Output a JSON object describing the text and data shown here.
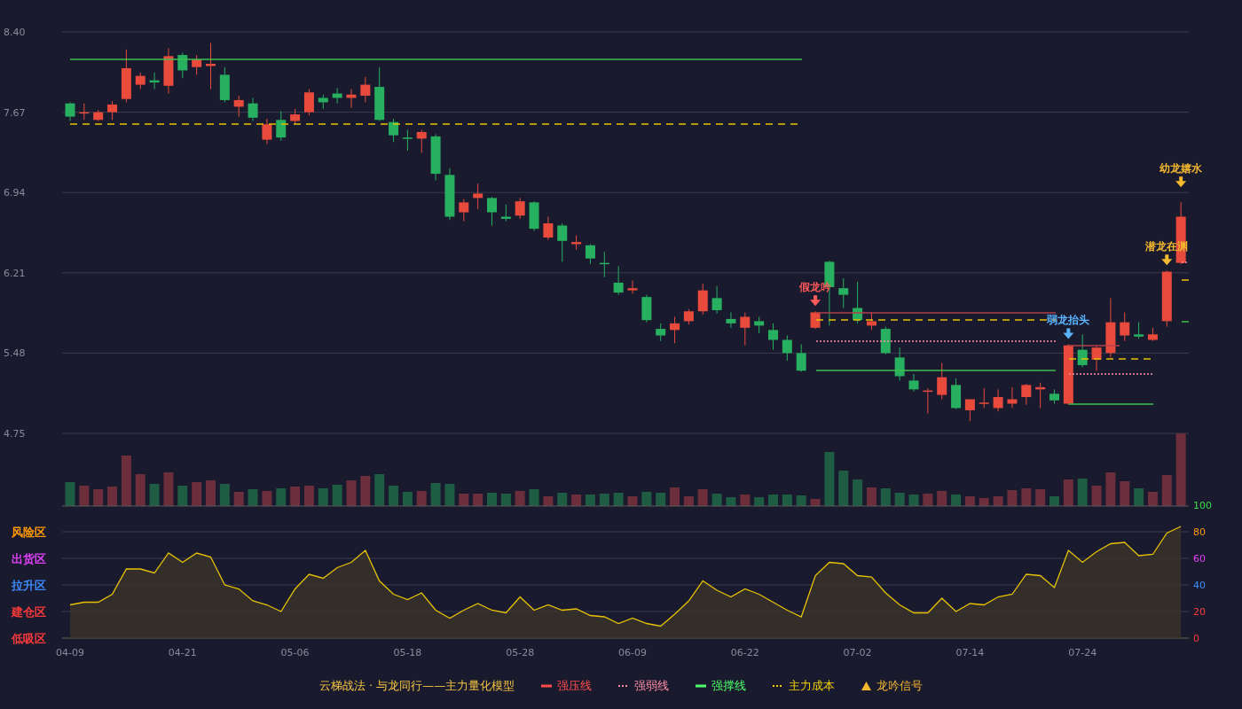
{
  "price_chart": {
    "signals": [
      {
        "text": "假龙吟",
        "color": "#ff5a5a"
      },
      {
        "text": "弱龙抬头",
        "color": "#5ab4ff"
      },
      {
        "text": "潜龙在渊",
        "color": "#f5b82e"
      },
      {
        "text": "幼龙嬉水",
        "color": "#f5b82e"
      }
    ],
    "chart_data": {
      "type": "candlestick",
      "grid": true,
      "ohlc": [
        [
          7.75,
          7.76,
          7.59,
          7.63
        ],
        [
          7.66,
          7.75,
          7.6,
          7.67
        ],
        [
          7.6,
          7.69,
          7.59,
          7.67
        ],
        [
          7.67,
          7.77,
          7.6,
          7.74
        ],
        [
          7.79,
          8.24,
          7.76,
          8.07
        ],
        [
          7.92,
          8.03,
          7.88,
          8.0
        ],
        [
          7.96,
          8.03,
          7.88,
          7.94
        ],
        [
          7.91,
          8.25,
          7.84,
          8.18
        ],
        [
          8.19,
          8.21,
          7.98,
          8.05
        ],
        [
          8.08,
          8.19,
          8.01,
          8.15
        ],
        [
          8.09,
          8.3,
          7.88,
          8.11
        ],
        [
          8.01,
          8.08,
          7.76,
          7.78
        ],
        [
          7.72,
          7.82,
          7.63,
          7.78
        ],
        [
          7.75,
          7.8,
          7.59,
          7.62
        ],
        [
          7.42,
          7.61,
          7.38,
          7.56
        ],
        [
          7.6,
          7.68,
          7.41,
          7.44
        ],
        [
          7.59,
          7.7,
          7.56,
          7.65
        ],
        [
          7.67,
          7.88,
          7.64,
          7.85
        ],
        [
          7.8,
          7.83,
          7.7,
          7.76
        ],
        [
          7.84,
          7.89,
          7.75,
          7.8
        ],
        [
          7.8,
          7.88,
          7.71,
          7.83
        ],
        [
          7.82,
          7.99,
          7.76,
          7.92
        ],
        [
          7.9,
          8.08,
          7.59,
          7.6
        ],
        [
          7.58,
          7.61,
          7.4,
          7.46
        ],
        [
          7.44,
          7.51,
          7.32,
          7.43
        ],
        [
          7.43,
          7.51,
          7.3,
          7.49
        ],
        [
          7.45,
          7.47,
          7.05,
          7.11
        ],
        [
          7.1,
          7.16,
          6.69,
          6.72
        ],
        [
          6.76,
          6.88,
          6.68,
          6.85
        ],
        [
          6.89,
          7.02,
          6.79,
          6.93
        ],
        [
          6.89,
          6.9,
          6.64,
          6.76
        ],
        [
          6.72,
          6.83,
          6.68,
          6.7
        ],
        [
          6.73,
          6.89,
          6.7,
          6.86
        ],
        [
          6.85,
          6.86,
          6.59,
          6.61
        ],
        [
          6.53,
          6.72,
          6.51,
          6.66
        ],
        [
          6.64,
          6.66,
          6.31,
          6.5
        ],
        [
          6.47,
          6.55,
          6.42,
          6.49
        ],
        [
          6.46,
          6.47,
          6.29,
          6.34
        ],
        [
          6.3,
          6.4,
          6.17,
          6.29
        ],
        [
          6.12,
          6.27,
          6.01,
          6.03
        ],
        [
          6.05,
          6.14,
          6.02,
          6.07
        ],
        [
          5.99,
          6.01,
          5.76,
          5.78
        ],
        [
          5.7,
          5.75,
          5.59,
          5.64
        ],
        [
          5.69,
          5.81,
          5.57,
          5.75
        ],
        [
          5.77,
          5.88,
          5.74,
          5.86
        ],
        [
          5.86,
          6.11,
          5.83,
          6.05
        ],
        [
          5.98,
          6.09,
          5.84,
          5.87
        ],
        [
          5.79,
          5.85,
          5.71,
          5.75
        ],
        [
          5.71,
          5.85,
          5.55,
          5.81
        ],
        [
          5.77,
          5.81,
          5.66,
          5.73
        ],
        [
          5.69,
          5.75,
          5.51,
          5.6
        ],
        [
          5.6,
          5.64,
          5.41,
          5.48
        ],
        [
          5.48,
          5.56,
          5.31,
          5.32
        ],
        [
          5.71,
          5.86,
          5.7,
          5.85
        ],
        [
          6.31,
          6.32,
          5.73,
          6.08
        ],
        [
          6.07,
          6.16,
          5.89,
          6.01
        ],
        [
          5.89,
          6.13,
          5.75,
          5.78
        ],
        [
          5.73,
          5.85,
          5.69,
          5.77
        ],
        [
          5.7,
          5.72,
          5.47,
          5.48
        ],
        [
          5.44,
          5.53,
          5.23,
          5.27
        ],
        [
          5.23,
          5.29,
          5.13,
          5.15
        ],
        [
          5.13,
          5.16,
          4.93,
          5.14
        ],
        [
          5.1,
          5.39,
          5.06,
          5.26
        ],
        [
          5.19,
          5.25,
          4.97,
          4.98
        ],
        [
          4.96,
          5.06,
          4.86,
          5.06
        ],
        [
          5.02,
          5.16,
          4.98,
          5.03
        ],
        [
          4.98,
          5.15,
          4.95,
          5.08
        ],
        [
          5.02,
          5.17,
          4.98,
          5.06
        ],
        [
          5.08,
          5.2,
          5.01,
          5.19
        ],
        [
          5.15,
          5.21,
          4.98,
          5.17
        ],
        [
          5.11,
          5.15,
          5.02,
          5.05
        ],
        [
          5.02,
          5.56,
          5.01,
          5.55
        ],
        [
          5.51,
          5.65,
          5.35,
          5.37
        ],
        [
          5.42,
          5.54,
          5.32,
          5.53
        ],
        [
          5.48,
          5.98,
          5.44,
          5.76
        ],
        [
          5.64,
          5.85,
          5.59,
          5.76
        ],
        [
          5.65,
          5.76,
          5.61,
          5.63
        ],
        [
          5.6,
          5.71,
          5.59,
          5.65
        ],
        [
          5.77,
          6.23,
          5.72,
          6.22
        ],
        [
          6.3,
          6.85,
          6.29,
          6.72
        ]
      ],
      "ylim": [
        4.75,
        8.4
      ],
      "yticks": [
        {
          "value": 8.4,
          "label": "8.40"
        },
        {
          "value": 7.67,
          "label": "7.67"
        },
        {
          "value": 6.94,
          "label": "6.94"
        },
        {
          "value": 6.21,
          "label": "6.21"
        },
        {
          "value": 5.48,
          "label": "5.48"
        },
        {
          "value": 4.75,
          "label": "4.75"
        }
      ]
    }
  },
  "oscillator": {
    "zones": [
      {
        "label": "风险区",
        "color": "#ff9a00"
      },
      {
        "label": "出货区",
        "color": "#e040fb"
      },
      {
        "label": "拉升区",
        "color": "#3d8bff"
      },
      {
        "label": "建仓区",
        "color": "#ff3b3b"
      },
      {
        "label": "低吸区",
        "color": "#ff3b3b"
      }
    ],
    "chart_data": {
      "type": "area",
      "grid": true,
      "categories": [
        "04-09",
        null,
        null,
        null,
        null,
        null,
        null,
        null,
        "04-21",
        null,
        null,
        null,
        null,
        null,
        null,
        null,
        "05-06",
        null,
        null,
        null,
        null,
        null,
        null,
        null,
        "05-18",
        null,
        null,
        null,
        null,
        null,
        null,
        null,
        "05-28",
        null,
        null,
        null,
        null,
        null,
        null,
        null,
        "06-09",
        null,
        null,
        null,
        null,
        null,
        null,
        null,
        "06-22",
        null,
        null,
        null,
        null,
        null,
        null,
        null,
        "07-02",
        null,
        null,
        null,
        null,
        null,
        null,
        null,
        "07-14",
        null,
        null,
        null,
        null,
        null,
        null,
        null,
        "07-24",
        null,
        null,
        null,
        null,
        null,
        null,
        null
      ],
      "series": [
        {
          "color": "#e6c200",
          "values": [
            25,
            27,
            27,
            33,
            52,
            52,
            49,
            64,
            57,
            64,
            61,
            40,
            37,
            28,
            25,
            20,
            37,
            48,
            45,
            53,
            57,
            66,
            43,
            33,
            29,
            34,
            21,
            15,
            21,
            26,
            21,
            19,
            31,
            21,
            25,
            21,
            22,
            17,
            16,
            11,
            15,
            11,
            9,
            18,
            28,
            43,
            36,
            31,
            37,
            33,
            27,
            21,
            16,
            47,
            57,
            56,
            47,
            46,
            34,
            25,
            19,
            19,
            30,
            20,
            26,
            25,
            31,
            33,
            48,
            47,
            38,
            66,
            57,
            65,
            71,
            72,
            62,
            63,
            79,
            84
          ]
        }
      ],
      "ylim": [
        0,
        100
      ],
      "yticks": [
        {
          "value": 100,
          "label": "100"
        },
        {
          "value": 80,
          "label": "80"
        },
        {
          "value": 60,
          "label": "60"
        },
        {
          "value": 40,
          "label": "40"
        },
        {
          "value": 20,
          "label": "20"
        },
        {
          "value": 0,
          "label": "0"
        }
      ]
    }
  },
  "legend": {
    "title": "云梯战法 · 与龙同行——主力量化模型",
    "items": [
      {
        "kind": "solid",
        "label": "强压线",
        "color": "#ff4d4d"
      },
      {
        "kind": "dotted",
        "label": "强弱线",
        "color": "#ff8fa3"
      },
      {
        "kind": "solid",
        "label": "强撑线",
        "color": "#4dff6a"
      },
      {
        "kind": "dotted",
        "label": "主力成本",
        "color": "#f5d000"
      },
      {
        "kind": "triangle",
        "label": "龙吟信号",
        "color": "#f5b82e"
      }
    ]
  }
}
